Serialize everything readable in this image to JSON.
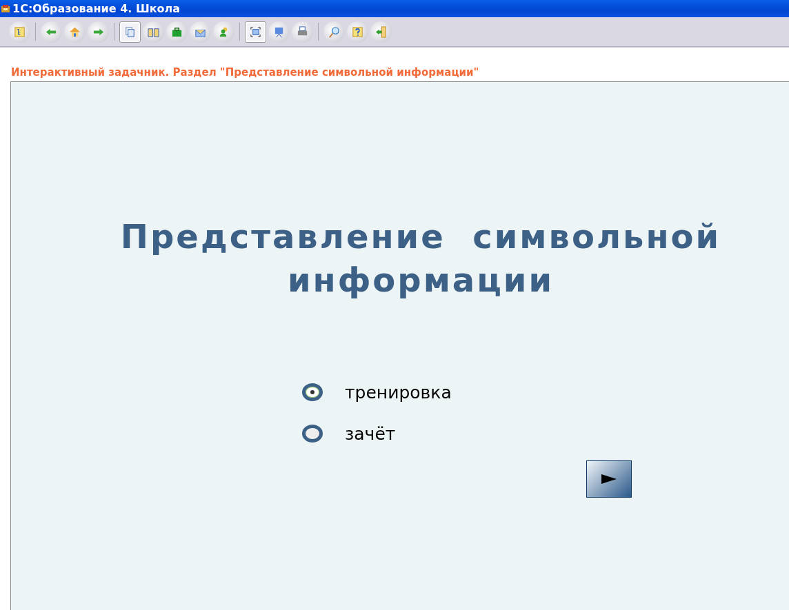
{
  "window": {
    "title": "1С:Образование 4. Школа"
  },
  "toolbar": {
    "groups": [
      [
        {
          "kind": "contents",
          "pressed": false
        }
      ],
      [
        {
          "kind": "back",
          "pressed": false
        },
        {
          "kind": "home",
          "pressed": false
        },
        {
          "kind": "forward",
          "pressed": false
        }
      ],
      [
        {
          "kind": "pages",
          "pressed": true
        },
        {
          "kind": "book",
          "pressed": false
        },
        {
          "kind": "briefcase",
          "pressed": false
        },
        {
          "kind": "mail",
          "pressed": false
        },
        {
          "kind": "user",
          "pressed": false
        }
      ],
      [
        {
          "kind": "fullscreen",
          "pressed": true
        },
        {
          "kind": "presentation",
          "pressed": false
        },
        {
          "kind": "print",
          "pressed": false
        }
      ],
      [
        {
          "kind": "search",
          "pressed": false
        },
        {
          "kind": "help",
          "pressed": false
        },
        {
          "kind": "exit",
          "pressed": false
        }
      ]
    ]
  },
  "breadcrumb": "Интерактивный задачник. Раздел \"Представление символьной информации\"",
  "slide": {
    "title_lines": [
      "Представление  символьной",
      "информации"
    ],
    "modes": [
      {
        "label": "тренировка",
        "selected": true
      },
      {
        "label": "зачёт",
        "selected": false
      }
    ]
  }
}
